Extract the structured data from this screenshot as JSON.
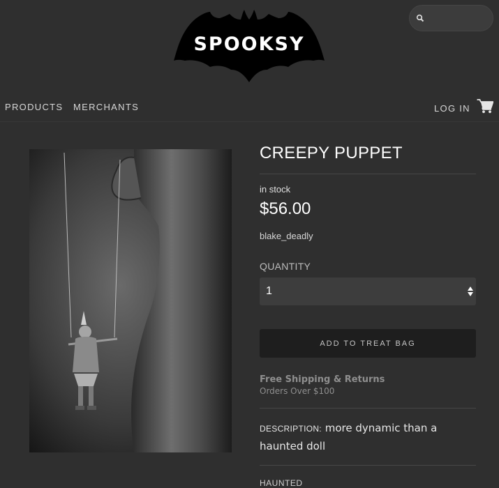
{
  "brand": {
    "logo_text": "SPOOKSY"
  },
  "search": {
    "placeholder": "",
    "value": ""
  },
  "nav": {
    "left": [
      {
        "label": "PRODUCTS"
      },
      {
        "label": "MERCHANTS"
      }
    ],
    "login_label": "LOG IN"
  },
  "icons": {
    "search": "search-icon",
    "cart": "shopping-cart-icon"
  },
  "product": {
    "title": "CREEPY PUPPET",
    "availability": "in stock",
    "price": "$56.00",
    "vendor": "blake_deadly",
    "quantity_label": "QUANTITY",
    "quantity_value": "1",
    "add_button_label": "ADD TO TREAT BAG",
    "shipping_title": "Free Shipping & Returns",
    "shipping_subtitle": "Orders Over $100",
    "description_label": "DESCRIPTION:",
    "description_text": "more dynamic than a haunted doll",
    "tag": "HAUNTED"
  },
  "colors": {
    "background": "#2f2f2f",
    "button": "#1e1e1e",
    "text": "#e6e6e6"
  }
}
